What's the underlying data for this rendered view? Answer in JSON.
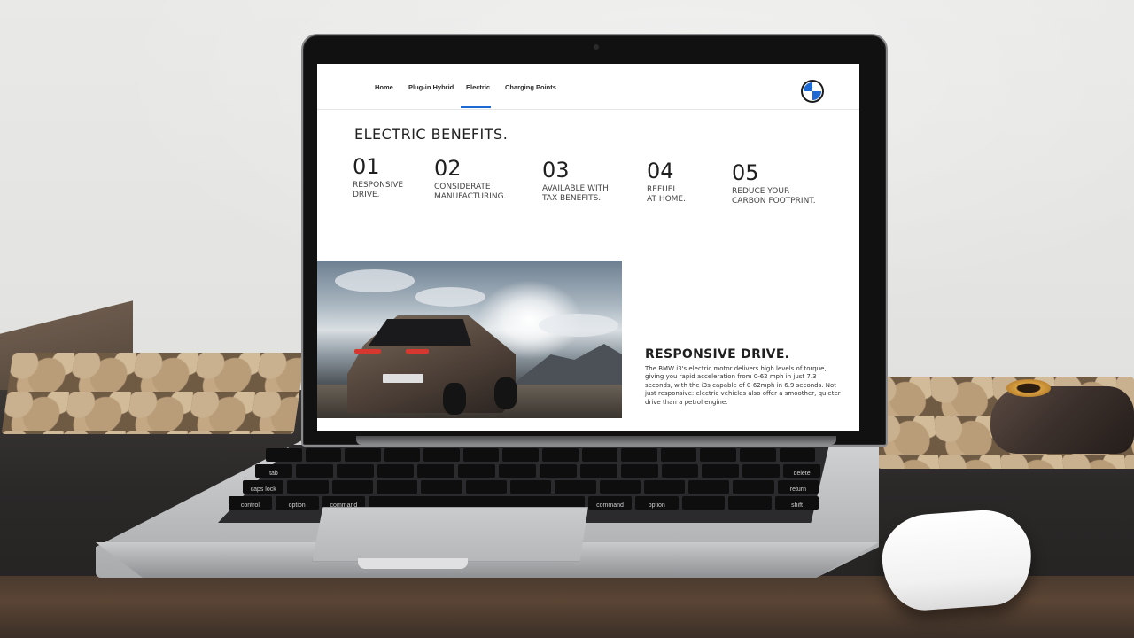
{
  "nav": {
    "items": [
      {
        "label": "Home",
        "active": false
      },
      {
        "label": "Plug-in Hybrid",
        "active": false
      },
      {
        "label": "Electric",
        "active": true
      },
      {
        "label": "Charging Points",
        "active": false
      }
    ]
  },
  "page": {
    "title": "ELECTRIC  BENEFITS.",
    "benefits": [
      {
        "number": "01",
        "label": "RESPONSIVE\nDRIVE."
      },
      {
        "number": "02",
        "label": "CONSIDERATE\nMANUFACTURING."
      },
      {
        "number": "03",
        "label": "AVAILABLE WITH\nTAX BENEFITS."
      },
      {
        "number": "04",
        "label": "REFUEL\nAT HOME."
      },
      {
        "number": "05",
        "label": "REDUCE YOUR\nCARBON FOOTPRINT."
      }
    ],
    "feature": {
      "title": "RESPONSIVE DRIVE.",
      "body": "The BMW i3's electric motor delivers high levels of torque, giving you rapid acceleration from 0-62 mph in just 7.3 seconds, with the i3s capable of 0-62mph in 6.9 seconds. Not just responsive: electric vehicles also offer a smoother, quieter drive than a petrol engine."
    }
  },
  "keyboard": {
    "keys": [
      "control",
      "option",
      "command",
      "command",
      "option",
      "shift",
      "return",
      "delete",
      "caps lock",
      "tab"
    ]
  },
  "colors": {
    "accent": "#1c69d4",
    "text": "#222222",
    "background": "#ffffff"
  },
  "icons": {
    "brand_logo": "bmw-roundel"
  }
}
